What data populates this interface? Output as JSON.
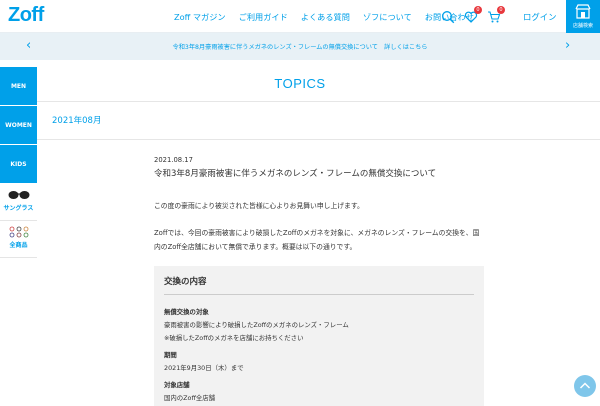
{
  "header": {
    "logo": "Zoff",
    "nav": [
      "Zoff マガジン",
      "ご利用ガイド",
      "よくある質問",
      "ゾフについて",
      "お問い合わせ"
    ],
    "favorites_badge": "0",
    "cart_badge": "0",
    "login_label": "ログイン",
    "store_search_label": "店舗検索"
  },
  "banner": {
    "text": "令和3年8月豪雨被害に伴うメガネのレンズ・フレームの無償交換について　詳しくはこちら"
  },
  "sidebar": {
    "items": [
      "MEN",
      "WOMEN",
      "KIDS"
    ],
    "sunglasses_label": "サングラス",
    "all_products_label": "全商品"
  },
  "main": {
    "heading": "TOPICS",
    "month": "2021年08月",
    "article": {
      "date": "2021.08.17",
      "title": "令和3年8月豪雨被害に伴うメガネのレンズ・フレームの無償交換について",
      "paragraph1": "この度の豪雨により被災された皆様に心よりお見舞い申し上げます。",
      "paragraph2": "Zoffでは、今回の豪雨被害により破損したZoffのメガネを対象に、メガネのレンズ・フレームの交換を、国内のZoff全店舗において無償で承ります。概要は以下の通りです。"
    },
    "details": {
      "heading": "交換の内容",
      "target_label": "無償交換の対象",
      "target_text": "豪雨被害の影響により破損したZoffのメガネのレンズ・フレーム",
      "target_note": "※破損したZoffのメガネを店舗にお持ちください",
      "period_label": "期間",
      "period_text": "2021年9月30日（木）まで",
      "stores_label": "対象店舗",
      "stores_text": "国内のZoff全店舗"
    }
  },
  "colors": {
    "accent": "#00a0e9",
    "banner_bg": "#e8f1f6",
    "box_bg": "#f2f2f2"
  }
}
